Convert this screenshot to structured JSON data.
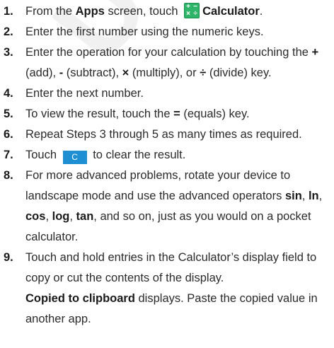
{
  "steps": [
    {
      "num": "1.",
      "t1": "From the ",
      "b1": "Apps",
      "t2": " screen, touch ",
      "icon": "calculator-app-icon",
      "b2": "Calculator",
      "t3": "."
    },
    {
      "num": "2.",
      "text": "Enter the first number using the numeric keys."
    },
    {
      "num": "3.",
      "t1": "Enter the operation for your calculation by touching the ",
      "op1": "+",
      "t2": " (add), ",
      "op2": "-",
      "t3": " (subtract), ",
      "op3": "×",
      "t4": " (multiply), or ",
      "op4": "÷",
      "t5": " (divide) key."
    },
    {
      "num": "4.",
      "text": "Enter the next number."
    },
    {
      "num": "5.",
      "t1": "To view the result, touch the ",
      "op": "=",
      "t2": " (equals) key."
    },
    {
      "num": "6.",
      "text": "Repeat Steps 3 through 5 as many times as required."
    },
    {
      "num": "7.",
      "t1": "Touch ",
      "key": "C",
      "t2": " to clear the result."
    },
    {
      "num": "8.",
      "t1": "For more advanced problems, rotate your device to landscape mode and use the advanced operators ",
      "f1": "sin",
      "s1": ", ",
      "f2": "ln",
      "s2": ", ",
      "f3": "cos",
      "s3": ", ",
      "f4": "log",
      "s4": ", ",
      "f5": "tan",
      "t2": ", and so on, just as you would on a pocket calculator."
    },
    {
      "num": "9.",
      "text": "Touch and hold entries in the Calculator’s display field to copy or cut the contents of the display.",
      "sub_b": "Copied to clipboard",
      "sub_t": " displays. Paste the copied value in another app."
    }
  ],
  "calc_icon_glyphs": [
    "+",
    "−",
    "×",
    "÷"
  ],
  "watermark": "DRAFT FOR INTERNAL USE ONLY",
  "colors": {
    "icon_green": "#2fb56a",
    "key_blue": "#1e8fd2",
    "text": "#2b2b2b"
  }
}
